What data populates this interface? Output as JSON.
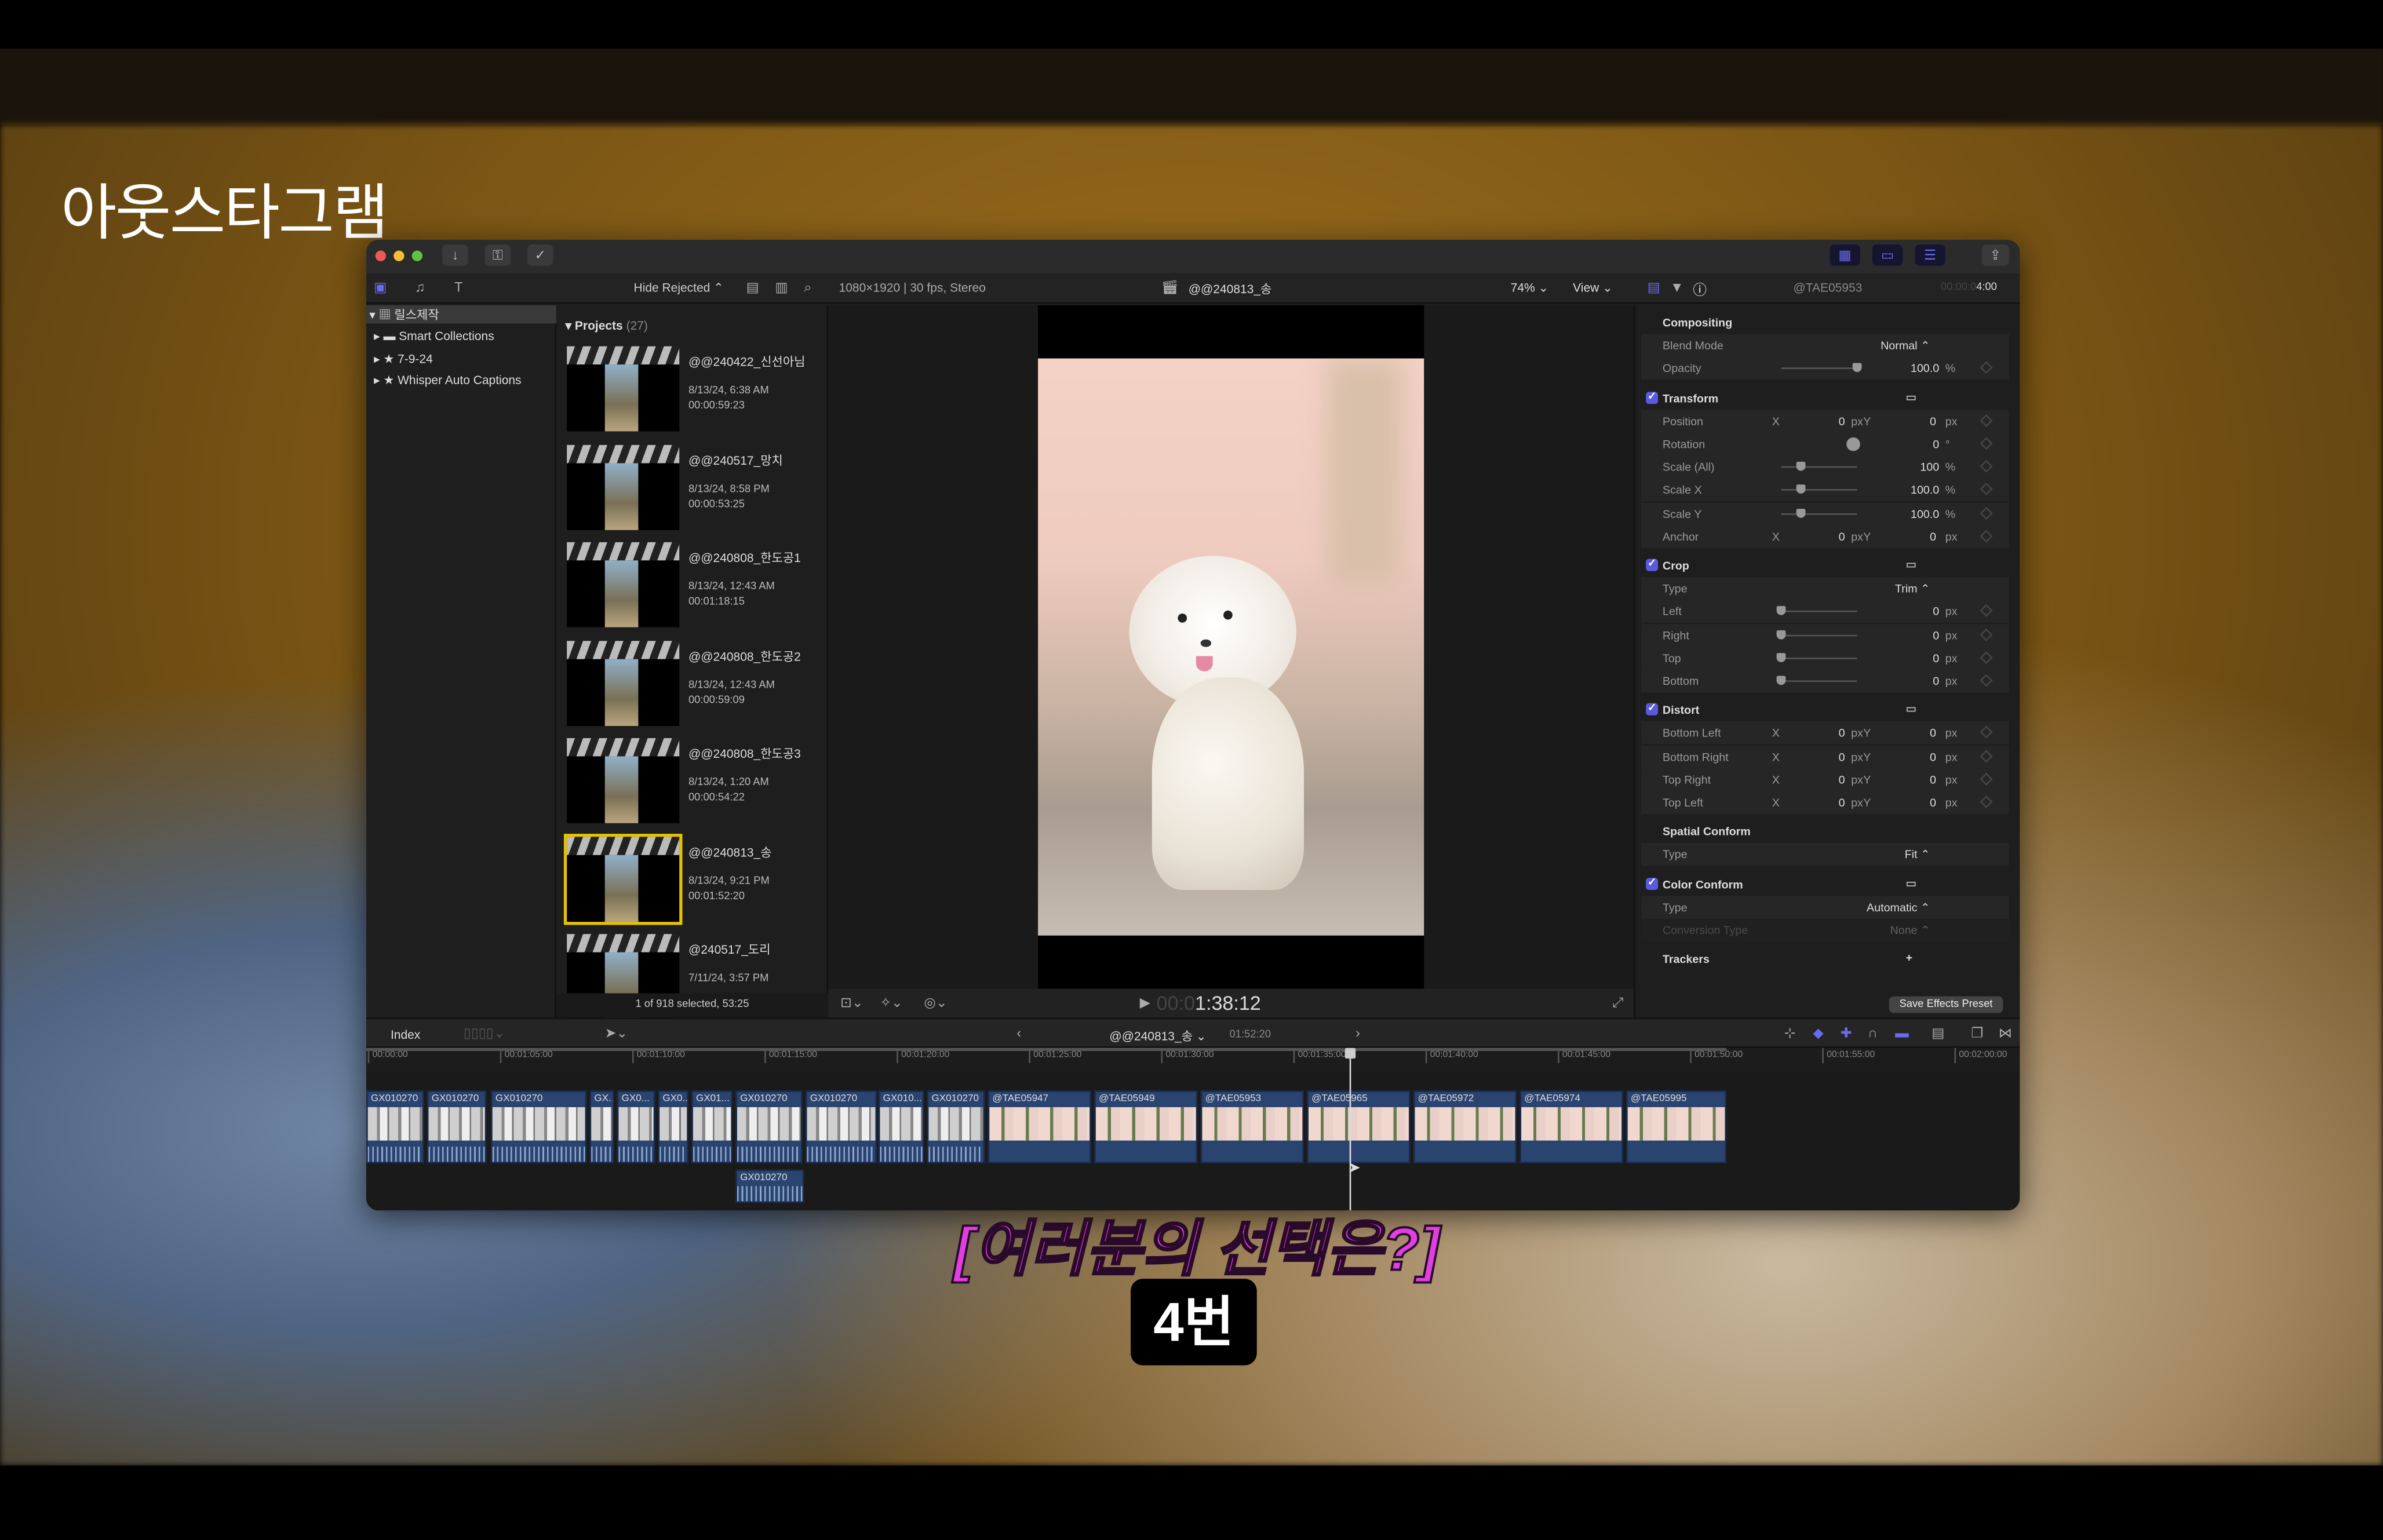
{
  "overlay": {
    "channel_title": "아웃스타그램",
    "subtitle": "[여러분의 선택은?]",
    "answer": "4번"
  },
  "colors": {
    "accent": "#5a5ae0",
    "selection": "#e6c200",
    "clip": "#2a4470",
    "subtitle": "#e040e0"
  },
  "libraries": {
    "items": [
      {
        "label": "릴스제작"
      },
      {
        "label": "Smart Collections"
      },
      {
        "label": "7-9-24"
      },
      {
        "label": "Whisper Auto Captions"
      }
    ]
  },
  "browser": {
    "filter": "Hide Rejected",
    "section": "Projects",
    "count": "(27)",
    "projects": [
      {
        "name": "@@240422_신선아님",
        "date": "8/13/24, 6:38 AM",
        "duration": "00:00:59:23"
      },
      {
        "name": "@@240517_망치",
        "date": "8/13/24, 8:58 PM",
        "duration": "00:00:53:25"
      },
      {
        "name": "@@240808_한도공1",
        "date": "8/13/24, 12:43 AM",
        "duration": "00:01:18:15"
      },
      {
        "name": "@@240808_한도공2",
        "date": "8/13/24, 12:43 AM",
        "duration": "00:00:59:09"
      },
      {
        "name": "@@240808_한도공3",
        "date": "8/13/24, 1:20 AM",
        "duration": "00:00:54:22"
      },
      {
        "name": "@@240813_송",
        "date": "8/13/24, 9:21 PM",
        "duration": "00:01:52:20",
        "selected": true
      },
      {
        "name": "@240517_도리",
        "date": "7/11/24, 3:57 PM",
        "duration": ""
      }
    ],
    "status": "1 of 918 selected, 53:25"
  },
  "viewer": {
    "format": "1080×1920 | 30 fps, Stereo",
    "project": "@@240813_송",
    "zoom": "74%",
    "view": "View",
    "timecode_dim": "00:0",
    "timecode": "1:38:12"
  },
  "inspector": {
    "clip": "@TAE05953",
    "duration_dim": "00:00:0",
    "duration": "4:00",
    "rows": [
      {
        "kind": "hdr",
        "label": "Compositing"
      },
      {
        "label": "Blend Mode",
        "dd": "Normal ⌃"
      },
      {
        "label": "Opacity",
        "slider": 1.0,
        "value": "100.0",
        "unit": "%",
        "kf": true
      },
      {
        "kind": "hdr",
        "check": true,
        "label": "Transform"
      },
      {
        "label": "Position",
        "x": "0",
        "y": "0",
        "unit": "px",
        "kf": true
      },
      {
        "label": "Rotation",
        "value": "0",
        "unit": "°",
        "kf": true
      },
      {
        "label": "Scale (All)",
        "slider": 0.25,
        "value": "100",
        "unit": "%",
        "kf": true
      },
      {
        "label": "Scale X",
        "slider": 0.25,
        "value": "100.0",
        "unit": "%",
        "kf": true
      },
      {
        "label": "Scale Y",
        "slider": 0.25,
        "value": "100.0",
        "unit": "%",
        "kf": true
      },
      {
        "label": "Anchor",
        "x": "0",
        "y": "0",
        "unit": "px",
        "kf": true
      },
      {
        "kind": "hdr",
        "check": true,
        "label": "Crop"
      },
      {
        "label": "Type",
        "dd": "Trim ⌃"
      },
      {
        "label": "Left",
        "slider": 0,
        "value": "0",
        "unit": "px",
        "kf": true
      },
      {
        "label": "Right",
        "slider": 0,
        "value": "0",
        "unit": "px",
        "kf": true
      },
      {
        "label": "Top",
        "slider": 0,
        "value": "0",
        "unit": "px",
        "kf": true
      },
      {
        "label": "Bottom",
        "slider": 0,
        "value": "0",
        "unit": "px",
        "kf": true
      },
      {
        "kind": "hdr",
        "check": true,
        "label": "Distort"
      },
      {
        "label": "Bottom Left",
        "x": "0",
        "y": "0",
        "unit": "px",
        "kf": true
      },
      {
        "label": "Bottom Right",
        "x": "0",
        "y": "0",
        "unit": "px",
        "kf": true
      },
      {
        "label": "Top Right",
        "x": "0",
        "y": "0",
        "unit": "px",
        "kf": true
      },
      {
        "label": "Top Left",
        "x": "0",
        "y": "0",
        "unit": "px",
        "kf": true
      },
      {
        "kind": "hdr",
        "label": "Spatial Conform"
      },
      {
        "label": "Type",
        "dd": "Fit ⌃"
      },
      {
        "kind": "hdr",
        "check": true,
        "label": "Color Conform"
      },
      {
        "label": "Type",
        "dd": "Automatic ⌃"
      },
      {
        "label": "Conversion Type",
        "dd": "None ⌃",
        "disabled": true
      },
      {
        "kind": "hdr",
        "label": "Trackers",
        "plus": "+"
      }
    ],
    "axis_x": "X",
    "axis_y": "Y",
    "save_preset": "Save Effects Preset"
  },
  "timeline": {
    "index": "Index",
    "project": "@@240813_송",
    "duration": "01:52:20",
    "ruler": [
      "00:00:00",
      "00:01:05:00",
      "00:01:10:00",
      "00:01:15:00",
      "00:01:20:00",
      "00:01:25:00",
      "00:01:30:00",
      "00:01:35:00",
      "00:01:40:00",
      "00:01:45:00",
      "00:01:50:00",
      "00:01:55:00",
      "00:02:00:00"
    ],
    "clips": [
      "GX010270",
      "GX010270",
      "GX010270",
      "GX...",
      "GX0...",
      "GX0...",
      "GX01...",
      "GX010270",
      "GX010270",
      "GX010...",
      "GX010270",
      "@TAE05947",
      "@TAE05949",
      "@TAE05953",
      "@TAE05965",
      "@TAE05972",
      "@TAE05974",
      "@TAE05995"
    ],
    "connected_clip": "GX010270"
  }
}
